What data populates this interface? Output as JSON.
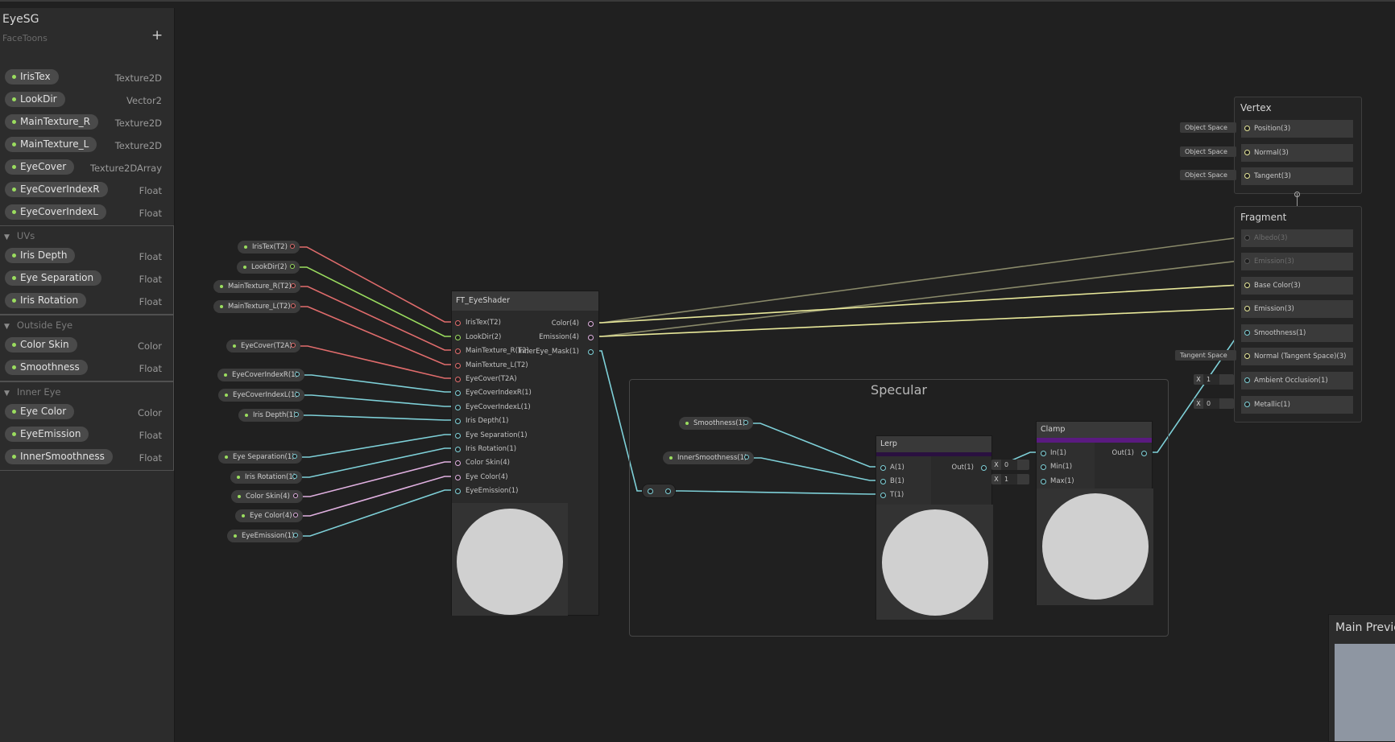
{
  "colors": {
    "texture": "#e06c6c",
    "vector": "#9bdd5f",
    "float": "#7ed0d8",
    "color": "#e0b0e0",
    "vec3": "#e8e89a",
    "lerp_bar": "#2a1040",
    "clamp_bar": "#5a1a80"
  },
  "blackboard": {
    "title": "EyeSG",
    "subtitle": "FaceToons",
    "add_icon": "+",
    "properties": [
      {
        "name": "IrisTex",
        "type": "Texture2D"
      },
      {
        "name": "LookDir",
        "type": "Vector2"
      },
      {
        "name": "MainTexture_R",
        "type": "Texture2D"
      },
      {
        "name": "MainTexture_L",
        "type": "Texture2D"
      },
      {
        "name": "EyeCover",
        "type": "Texture2DArray"
      },
      {
        "name": "EyeCoverIndexR",
        "type": "Float"
      },
      {
        "name": "EyeCoverIndexL",
        "type": "Float"
      }
    ],
    "categories": [
      {
        "name": "UVs",
        "items": [
          {
            "name": "Iris Depth",
            "type": "Float"
          },
          {
            "name": "Eye Separation",
            "type": "Float"
          },
          {
            "name": "Iris Rotation",
            "type": "Float"
          }
        ]
      },
      {
        "name": "Outside Eye",
        "items": [
          {
            "name": "Color Skin",
            "type": "Color"
          },
          {
            "name": "Smoothness",
            "type": "Float"
          }
        ]
      },
      {
        "name": "Inner Eye",
        "items": [
          {
            "name": "Eye Color",
            "type": "Color"
          },
          {
            "name": "EyeEmission",
            "type": "Float"
          },
          {
            "name": "InnerSmoothness",
            "type": "Float"
          }
        ]
      }
    ]
  },
  "property_nodes": [
    {
      "label": "IrisTex(T2)",
      "kind": "texture"
    },
    {
      "label": "LookDir(2)",
      "kind": "vector"
    },
    {
      "label": "MainTexture_R(T2)",
      "kind": "texture"
    },
    {
      "label": "MainTexture_L(T2)",
      "kind": "texture"
    },
    {
      "label": "EyeCover(T2A)",
      "kind": "texture"
    },
    {
      "label": "EyeCoverIndexR(1)",
      "kind": "float"
    },
    {
      "label": "EyeCoverIndexL(1)",
      "kind": "float"
    },
    {
      "label": "Iris Depth(1)",
      "kind": "float"
    },
    {
      "label": "Eye Separation(1)",
      "kind": "float"
    },
    {
      "label": "Iris Rotation(1)",
      "kind": "float"
    },
    {
      "label": "Color Skin(4)",
      "kind": "color"
    },
    {
      "label": "Eye Color(4)",
      "kind": "color"
    },
    {
      "label": "EyeEmission(1)",
      "kind": "float"
    },
    {
      "label": "Smoothness(1)",
      "kind": "float"
    },
    {
      "label": "InnerSmoothness(1)",
      "kind": "float"
    }
  ],
  "eye_shader": {
    "title": "FT_EyeShader",
    "inputs": [
      {
        "label": "IrisTex(T2)",
        "kind": "texture"
      },
      {
        "label": "LookDir(2)",
        "kind": "vector"
      },
      {
        "label": "MainTexture_R(T2)",
        "kind": "texture"
      },
      {
        "label": "MainTexture_L(T2)",
        "kind": "texture"
      },
      {
        "label": "EyeCover(T2A)",
        "kind": "texture"
      },
      {
        "label": "EyeCoverIndexR(1)",
        "kind": "float"
      },
      {
        "label": "EyeCoverIndexL(1)",
        "kind": "float"
      },
      {
        "label": "Iris Depth(1)",
        "kind": "float"
      },
      {
        "label": "Eye Separation(1)",
        "kind": "float"
      },
      {
        "label": "Iris Rotation(1)",
        "kind": "float"
      },
      {
        "label": "Color Skin(4)",
        "kind": "color"
      },
      {
        "label": "Eye Color(4)",
        "kind": "color"
      },
      {
        "label": "EyeEmission(1)",
        "kind": "float"
      }
    ],
    "outputs": [
      {
        "label": "Color(4)",
        "kind": "color"
      },
      {
        "label": "Emission(4)",
        "kind": "color"
      },
      {
        "label": "InnerEye_Mask(1)",
        "kind": "float"
      }
    ]
  },
  "specular_group": {
    "title": "Specular",
    "lerp": {
      "title": "Lerp",
      "inputs": [
        "A(1)",
        "B(1)",
        "T(1)"
      ],
      "output": "Out(1)"
    },
    "clamp": {
      "title": "Clamp",
      "inputs": [
        "In(1)",
        "Min(1)",
        "Max(1)"
      ],
      "output": "Out(1)",
      "min_label": "X",
      "min_value": "0",
      "max_label": "X",
      "max_value": "1"
    }
  },
  "vertex_block": {
    "title": "Vertex",
    "items": [
      {
        "label": "Position(3)",
        "space": "Object Space"
      },
      {
        "label": "Normal(3)",
        "space": "Object Space"
      },
      {
        "label": "Tangent(3)",
        "space": "Object Space"
      }
    ]
  },
  "fragment_block": {
    "title": "Fragment",
    "items": [
      {
        "label": "Albedo(3)",
        "dim": true
      },
      {
        "label": "Emission(3)",
        "dim": true
      },
      {
        "label": "Base Color(3)",
        "dim": false
      },
      {
        "label": "Emission(3)",
        "dim": false
      },
      {
        "label": "Smoothness(1)",
        "dim": false
      },
      {
        "label": "Normal (Tangent Space)(3)",
        "dim": false,
        "space": "Tangent Space"
      },
      {
        "label": "Ambient Occlusion(1)",
        "dim": false,
        "x_label": "X",
        "x_value": "1"
      },
      {
        "label": "Metallic(1)",
        "dim": false,
        "x_label": "X",
        "x_value": "0"
      }
    ]
  },
  "main_preview": {
    "title": "Main Preview"
  }
}
